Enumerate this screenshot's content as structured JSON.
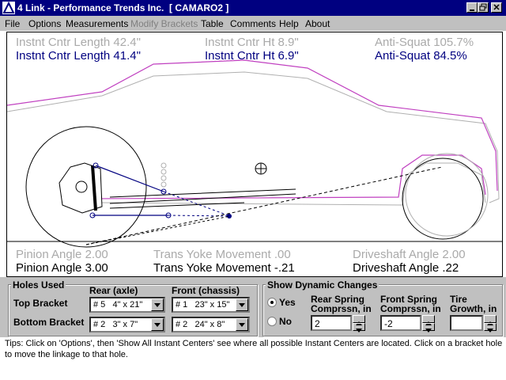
{
  "window": {
    "title": "4 Link - Performance Trends Inc.  [ CAMARO2 ]"
  },
  "menu": [
    "File",
    "Options",
    "Measurements",
    "Modify Brackets",
    "Table",
    "Comments",
    "Help",
    "About"
  ],
  "readouts": {
    "ghost": {
      "ic_length": "Instnt Cntr Length 42.4\"",
      "ic_height": "Instnt Cntr Ht  8.9\"",
      "anti_squat": "Anti-Squat  105.7%",
      "pinion": "Pinion Angle  2.00",
      "yoke": "Trans Yoke Movement  .00",
      "driveshaft": "Driveshaft Angle  2.00"
    },
    "current": {
      "ic_length": "Instnt Cntr Length 41.4\"",
      "ic_height": "Instnt Cntr Ht  6.9\"",
      "anti_squat": "Anti-Squat  84.5%",
      "pinion": "Pinion Angle  3.00",
      "yoke": "Trans Yoke Movement -.21",
      "driveshaft": "Driveshaft Angle  .22"
    }
  },
  "holes": {
    "title": "Holes Used",
    "rear_header": "Rear (axle)",
    "front_header": "Front (chassis)",
    "top_label": "Top Bracket",
    "bottom_label": "Bottom Bracket",
    "top_rear": "# 5   4\" x 21\"",
    "top_front": "# 1   23\" x 15\"",
    "bottom_rear": "# 2   3\" x 7\"",
    "bottom_front": "# 2   24\" x 8\""
  },
  "dynamic": {
    "title": "Show Dynamic Changes",
    "yes_label": "Yes",
    "no_label": "No",
    "rear_label_1": "Rear Spring",
    "rear_label_2": "Comprssn, in",
    "front_label_1": "Front Spring",
    "front_label_2": "Comprssn, in",
    "tire_label_1": "Tire",
    "tire_label_2": "Growth, in",
    "rear_value": "2",
    "front_value": "-2",
    "tire_value": "",
    "selected": "Yes"
  },
  "tips": "Tips:  Click on 'Options', then 'Show All Instant Centers' see where all possible Instant Centers are located.  Click on a bracket hole to move the linkage to that hole."
}
